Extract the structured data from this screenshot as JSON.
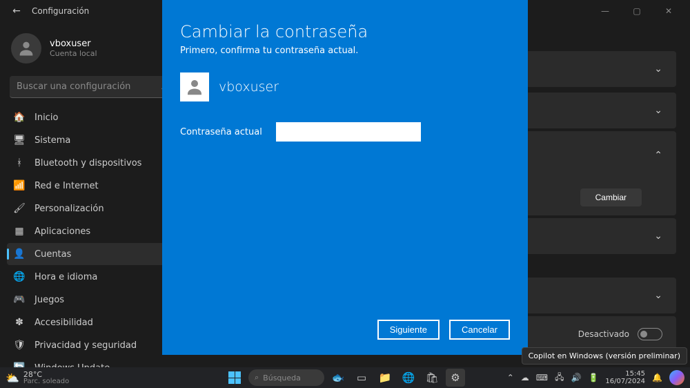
{
  "window": {
    "title": "Configuración",
    "minimize": "—",
    "maximize": "▢",
    "close": "✕"
  },
  "user": {
    "name": "vboxuser",
    "type": "Cuenta local"
  },
  "search": {
    "placeholder": "Buscar una configuración",
    "icon": "⌕"
  },
  "nav": {
    "items": [
      {
        "label": "Inicio",
        "icon": "🏠"
      },
      {
        "label": "Sistema",
        "icon": "🖥"
      },
      {
        "label": "Bluetooth y dispositivos",
        "icon": "ᚼ"
      },
      {
        "label": "Red e Internet",
        "icon": "📶"
      },
      {
        "label": "Personalización",
        "icon": "🖌"
      },
      {
        "label": "Aplicaciones",
        "icon": "▦"
      },
      {
        "label": "Cuentas",
        "icon": "👤",
        "active": true
      },
      {
        "label": "Hora e idioma",
        "icon": "🌐"
      },
      {
        "label": "Juegos",
        "icon": "🎮"
      },
      {
        "label": "Accesibilidad",
        "icon": "✽"
      },
      {
        "label": "Privacidad y seguridad",
        "icon": "🛡"
      },
      {
        "label": "Windows Update",
        "icon": "🔄"
      }
    ]
  },
  "content": {
    "cambiar_label": "Cambiar",
    "toggle_label": "Desactivado"
  },
  "modal": {
    "title": "Cambiar la contraseña",
    "subtitle": "Primero, confirma tu contraseña actual.",
    "username": "vboxuser",
    "field_label": "Contraseña actual",
    "next": "Siguiente",
    "cancel": "Cancelar"
  },
  "tooltip": {
    "text": "Copilot en Windows (versión preliminar)"
  },
  "taskbar": {
    "weather_temp": "28°C",
    "weather_desc": "Parc. soleado",
    "search_label": "Búsqueda",
    "time": "15:45",
    "date": "16/07/2024"
  }
}
